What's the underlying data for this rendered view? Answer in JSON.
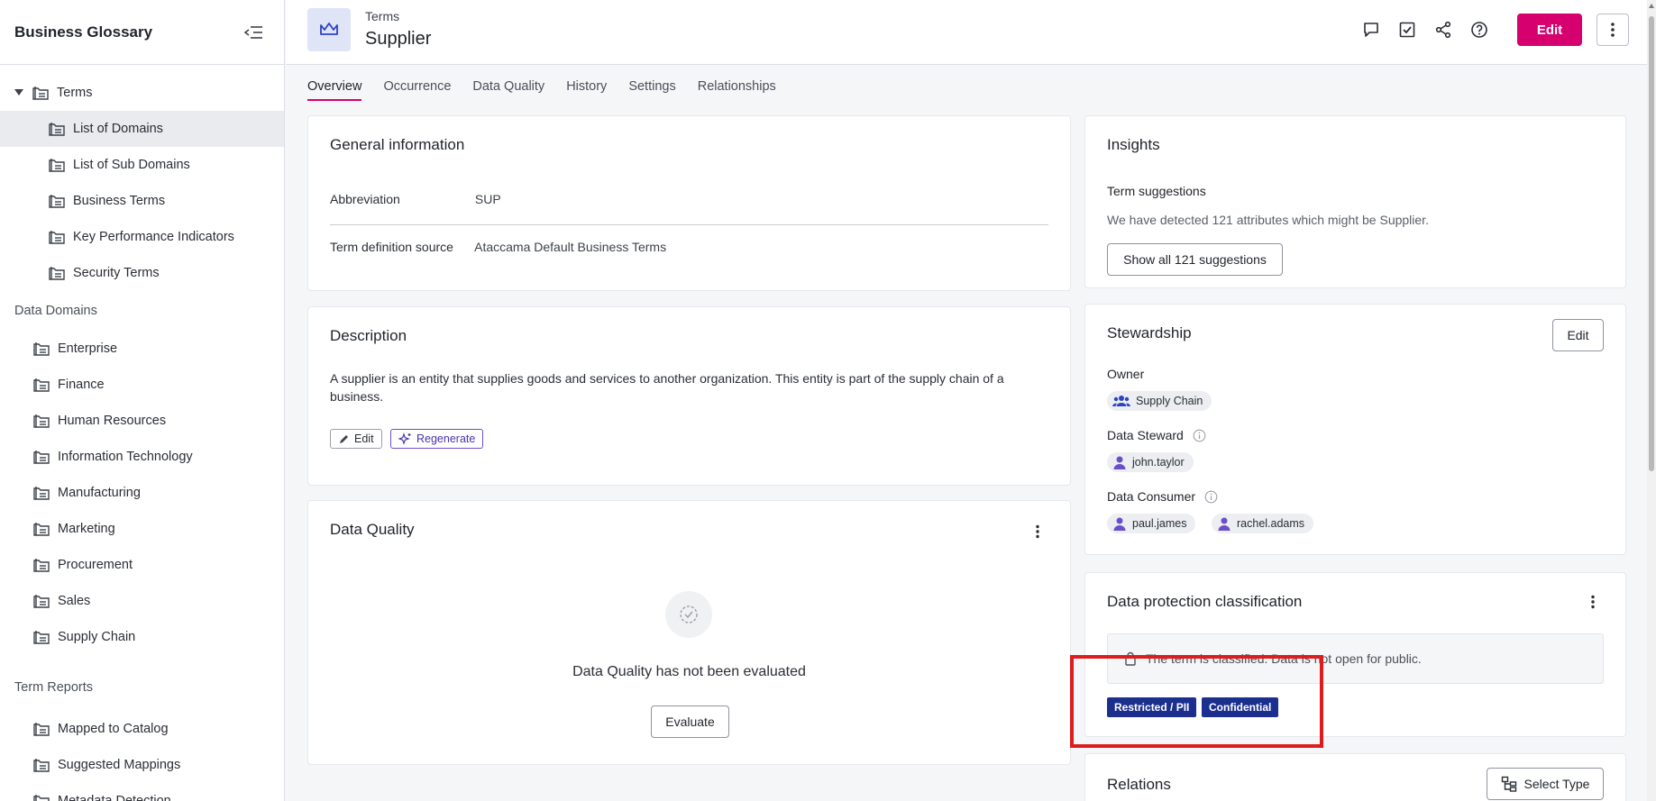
{
  "sidebar": {
    "title": "Business Glossary",
    "terms_root": {
      "label": "Terms",
      "expanded": true
    },
    "terms_children": [
      {
        "label": "List of Domains",
        "active": true
      },
      {
        "label": "List of Sub Domains"
      },
      {
        "label": "Business Terms"
      },
      {
        "label": "Key Performance Indicators"
      },
      {
        "label": "Security Terms"
      }
    ],
    "data_domains_title": "Data Domains",
    "data_domains": [
      "Enterprise",
      "Finance",
      "Human Resources",
      "Information Technology",
      "Manufacturing",
      "Marketing",
      "Procurement",
      "Sales",
      "Supply Chain"
    ],
    "term_reports_title": "Term Reports",
    "term_reports": [
      "Mapped to Catalog",
      "Suggested Mappings",
      "Metadata Detection"
    ]
  },
  "header": {
    "breadcrumb": "Terms",
    "title": "Supplier",
    "edit_label": "Edit"
  },
  "tabs": [
    "Overview",
    "Occurrence",
    "Data Quality",
    "History",
    "Settings",
    "Relationships"
  ],
  "general_info": {
    "title": "General information",
    "abbreviation_label": "Abbreviation",
    "abbreviation_value": "SUP",
    "source_label": "Term definition source",
    "source_value": "Ataccama Default Business Terms"
  },
  "description": {
    "title": "Description",
    "text": "A supplier is an entity that supplies goods and services to another organization. This entity is part of the supply chain of a business.",
    "edit_label": "Edit",
    "regenerate_label": "Regenerate"
  },
  "data_quality": {
    "title": "Data Quality",
    "empty_text": "Data Quality has not been evaluated",
    "evaluate_label": "Evaluate"
  },
  "insights": {
    "title": "Insights",
    "subtitle": "Term suggestions",
    "text": "We have detected 121 attributes which might be Supplier.",
    "button_label": "Show all 121 suggestions"
  },
  "stewardship": {
    "title": "Stewardship",
    "edit_label": "Edit",
    "owner_label": "Owner",
    "owner": "Supply Chain",
    "steward_label": "Data Steward",
    "steward": "john.taylor",
    "consumer_label": "Data Consumer",
    "consumers": [
      "paul.james",
      "rachel.adams"
    ]
  },
  "data_protection": {
    "title": "Data protection classification",
    "note": "The term is classified. Data is not open for public.",
    "tags": [
      "Restricted / PII",
      "Confidential"
    ]
  },
  "relations": {
    "title": "Relations",
    "select_type_label": "Select Type"
  },
  "colors": {
    "accent": "#d6006e",
    "tag_bg": "#1b2f8f",
    "highlight": "#dd1d1d",
    "term_icon_bg": "#dfe4f7"
  }
}
